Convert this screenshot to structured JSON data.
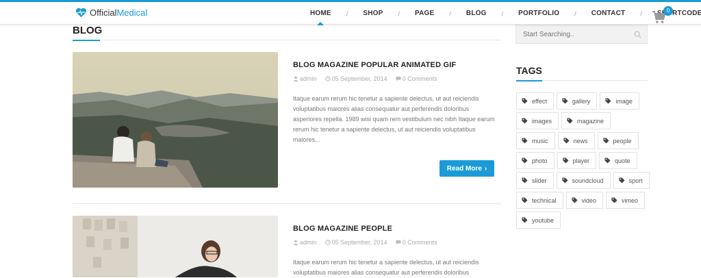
{
  "header": {
    "logo_part1": "Official",
    "logo_part2": "Medical",
    "nav": [
      {
        "label": "HOME",
        "active": true
      },
      {
        "label": "SHOP"
      },
      {
        "label": "PAGE"
      },
      {
        "label": "BLOG"
      },
      {
        "label": "PORTFOLIO"
      },
      {
        "label": "CONTACT"
      },
      {
        "label": "SHORTCODES"
      }
    ],
    "nav_separator": "/",
    "cart_count": "0",
    "cart_icon": "shopping-cart-icon"
  },
  "page": {
    "title": "BLOG"
  },
  "posts": [
    {
      "title": "BLOG MAGAZINE POPULAR ANIMATED GIF",
      "author": "admin",
      "date": "05 September, 2014",
      "comments": "0 Comments",
      "excerpt": "Itaque earum rerum hic tenetur a sapiente delectus, ut aut reiciendis voluptatibus maiores alias consequatur aut perferendis doloribus asperiores repella. 1989 wisi quam rem vestibulum nec nibh Itaque earum rerum hic tenetur a sapiente delectus, ut aut reiciendis voluptatibus maiores...",
      "read_more": "Read More"
    },
    {
      "title": "BLOG MAGAZINE PEOPLE",
      "author": "admin",
      "date": "05 September, 2014",
      "comments": "0 Comments",
      "excerpt": "Itaque earum rerum hic tenetur a sapiente delectus, ut aut reiciendis voluptatibus maiores alias consequatur aut perferendis doloribus"
    }
  ],
  "sidebar": {
    "search_placeholder": "Start Searching..",
    "tags_title": "TAGS",
    "tags": [
      "effect",
      "gallery",
      "image",
      "images",
      "magazine",
      "music",
      "news",
      "people",
      "photo",
      "player",
      "quote",
      "slider",
      "soundcloud",
      "sport",
      "technical",
      "video",
      "vimeo",
      "youtube"
    ]
  },
  "colors": {
    "accent": "#1a9bd7"
  }
}
